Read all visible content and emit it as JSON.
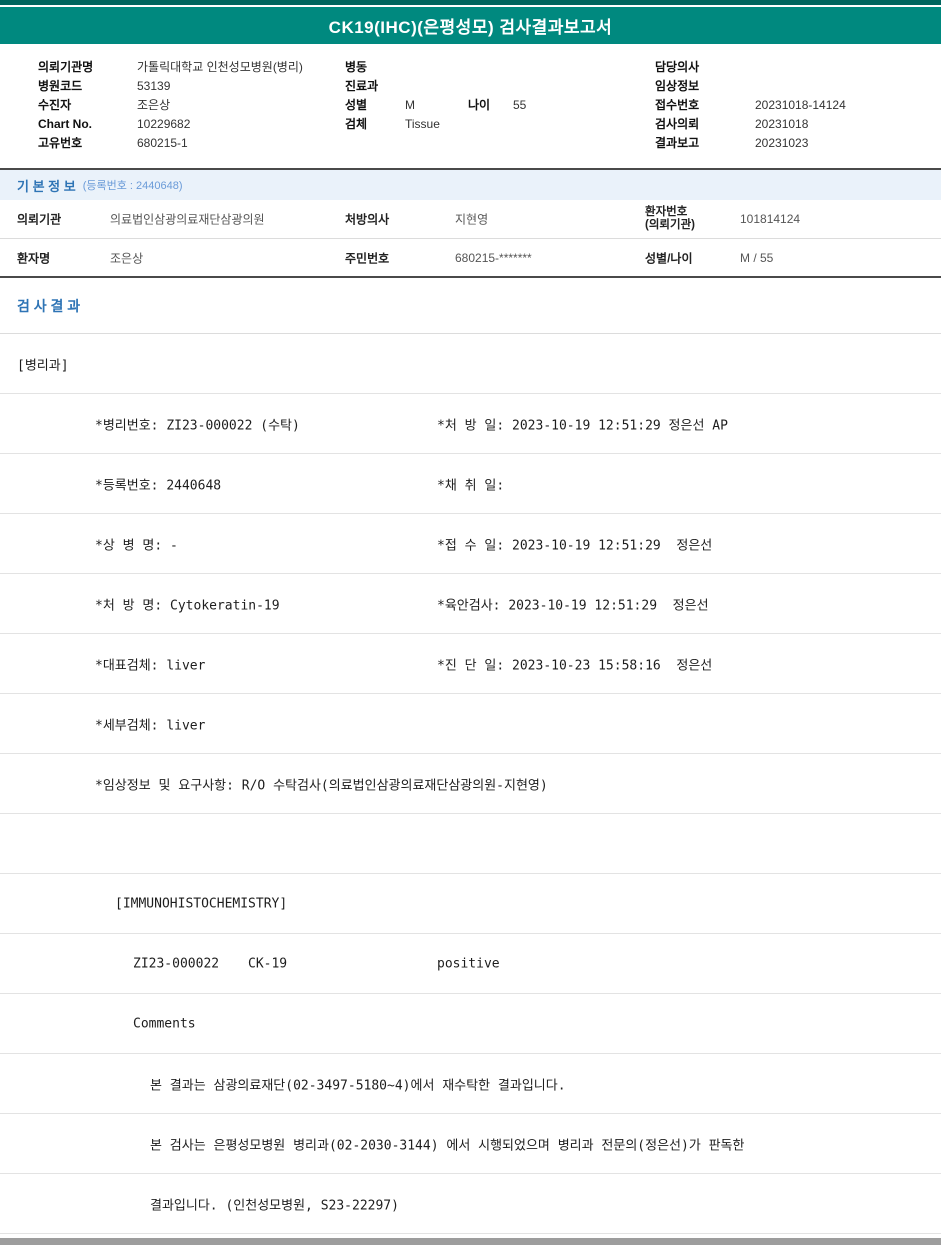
{
  "title": "CK19(IHC)(은평성모) 검사결과보고서",
  "colors": {
    "header_teal": "#00897F",
    "header_teal_dark": "#00655E",
    "section_blue": "#2E74B5",
    "section_band_bg": "#EAF2FA",
    "bottom_bar_gray": "#9D9D9D"
  },
  "header": {
    "left": [
      {
        "label": "의뢰기관명",
        "value": "가톨릭대학교 인천성모병원(병리)"
      },
      {
        "label": "병원코드",
        "value": "53139"
      },
      {
        "label": "수진자",
        "value": "조은상"
      },
      {
        "label": "Chart No.",
        "value": "10229682"
      },
      {
        "label": "고유번호",
        "value": "680215-1"
      }
    ],
    "middle": [
      {
        "label": "병동",
        "value": ""
      },
      {
        "label": "진료과",
        "value": ""
      },
      {
        "label": "성별",
        "value": "M",
        "label2": "나이",
        "value2": "55"
      },
      {
        "label": "검체",
        "value": "Tissue"
      }
    ],
    "right": [
      {
        "label": "담당의사",
        "value": ""
      },
      {
        "label": "임상정보",
        "value": ""
      },
      {
        "label": "접수번호",
        "value": "20231018-14124"
      },
      {
        "label": "검사의뢰",
        "value": "20231018"
      },
      {
        "label": "결과보고",
        "value": "20231023"
      }
    ]
  },
  "basic_info": {
    "section_title": "기 본 정 보",
    "section_sub": "(등록번호 : 2440648)",
    "rows": [
      {
        "c1l": "의뢰기관",
        "c1v": "의료법인삼광의료재단삼광의원",
        "c2l": "처방의사",
        "c2v": "지현영",
        "c3l": "환자번호",
        "c3l2": "(의뢰기관)",
        "c3v": "101814124"
      },
      {
        "c1l": "환자명",
        "c1v": "조은상",
        "c2l": "주민번호",
        "c2v": "680215-*******",
        "c3l": "성별/나이",
        "c3v": "M / 55"
      }
    ]
  },
  "results": {
    "section_title": "검 사 결 과",
    "dept": "[병리과]",
    "fields": [
      {
        "left": "*병리번호: ZI23-000022 (수탁)",
        "right": "*처 방 일: 2023-10-19 12:51:29 정은선 AP"
      },
      {
        "left": "*등록번호: 2440648",
        "right": "*채 취 일:"
      },
      {
        "left": "*상 병 명: -",
        "right": "*접 수 일: 2023-10-19 12:51:29  정은선"
      },
      {
        "left": "*처 방 명: Cytokeratin-19",
        "right": "*육안검사: 2023-10-19 12:51:29  정은선"
      },
      {
        "left": "*대표검체: liver",
        "right": "*진 단 일: 2023-10-23 15:58:16  정은선"
      },
      {
        "left": "*세부검체: liver",
        "right": ""
      },
      {
        "left": "*임상정보 및 요구사항: R/O 수탁검사(의료법인삼광의료재단삼광의원-지현영)",
        "right": ""
      }
    ],
    "subsection": "[IMMUNOHISTOCHEMISTRY]",
    "result_line": {
      "code": "ZI23-000022",
      "test": "CK-19",
      "value": "positive"
    },
    "comments_label": "Comments",
    "comments": [
      "본 결과는 삼광의료재단(02-3497-5180~4)에서 재수탁한 결과입니다.",
      "본 검사는 은평성모병원 병리과(02-2030-3144) 에서 시행되었으며 병리과 전문의(정은선)가 판독한",
      "결과입니다. (인천성모병원, S23-22297)"
    ]
  }
}
